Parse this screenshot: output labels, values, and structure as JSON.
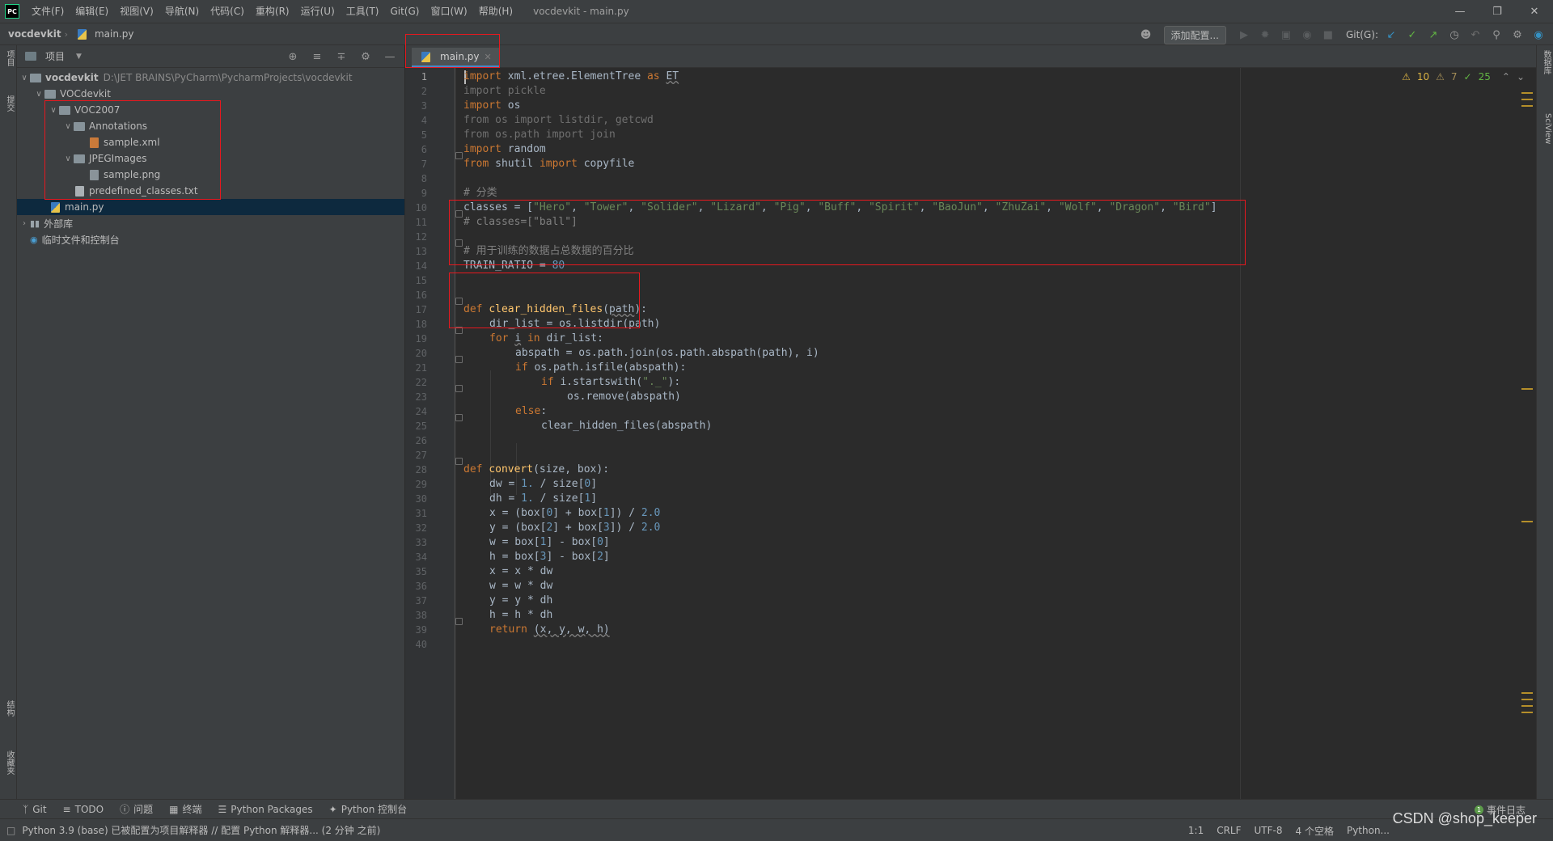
{
  "app": {
    "logo": "PC",
    "menu": [
      "文件(F)",
      "编辑(E)",
      "视图(V)",
      "导航(N)",
      "代码(C)",
      "重构(R)",
      "运行(U)",
      "工具(T)",
      "Git(G)",
      "窗口(W)",
      "帮助(H)"
    ],
    "window_title": "vocdevkit - main.py"
  },
  "navbar": {
    "project": "vocdevkit",
    "file": "main.py",
    "add_config": "添加配置...",
    "git_label": "Git(G):"
  },
  "left_strip": {
    "project": "项目",
    "commit": "提交",
    "structure": "结构",
    "bookmarks": "收藏夹"
  },
  "right_strip": {
    "database": "数据库",
    "sciview": "SciView"
  },
  "project_panel": {
    "title": "项目",
    "tree": {
      "root": "vocdevkit",
      "root_path": "D:\\JET BRAINS\\PyCharm\\PycharmProjects\\vocdevkit",
      "vocdevkit_dir": "VOCdevkit",
      "voc2007": "VOC2007",
      "annotations": "Annotations",
      "sample_xml": "sample.xml",
      "jpegimages": "JPEGImages",
      "sample_png": "sample.png",
      "predefined": "predefined_classes.txt",
      "main_py": "main.py",
      "external_libs": "外部库",
      "scratches": "临时文件和控制台"
    }
  },
  "editor": {
    "tab_label": "main.py",
    "inspections": {
      "warnings": "10",
      "weak_warnings": "7",
      "ok": "25"
    },
    "line_numbers": [
      "1",
      "2",
      "3",
      "4",
      "5",
      "6",
      "7",
      "8",
      "9",
      "10",
      "11",
      "12",
      "13",
      "14",
      "15",
      "16",
      "17",
      "18",
      "19",
      "20",
      "21",
      "22",
      "23",
      "24",
      "25",
      "26",
      "27",
      "28",
      "29",
      "30",
      "31",
      "32",
      "33",
      "34",
      "35",
      "36",
      "37",
      "38",
      "39",
      "40"
    ]
  },
  "code": {
    "l1": {
      "kw1": "import",
      "mid": " xml.etree.ElementTree ",
      "kw2": "as",
      "alias": "ET"
    },
    "l2": "import pickle",
    "l3": {
      "kw": "import",
      "rest": " os"
    },
    "l4": "from os import listdir, getcwd",
    "l5": "from os.path import join",
    "l6": {
      "kw": "import",
      "rest": " random"
    },
    "l7": {
      "kw1": "from",
      "mid": " shutil ",
      "kw2": "import",
      "rest": " copyfile"
    },
    "l9": "# 分类",
    "l10": {
      "prefix": "classes = [",
      "items": [
        "\"Hero\"",
        "\"Tower\"",
        "\"Solider\"",
        "\"Lizard\"",
        "\"Pig\"",
        "\"Buff\"",
        "\"Spirit\"",
        "\"BaoJun\"",
        "\"ZhuZai\"",
        "\"Wolf\"",
        "\"Dragon\"",
        "\"Bird\""
      ],
      "suffix": "]"
    },
    "l11": "# classes=[\"ball\"]",
    "l13": "# 用于训练的数据占总数据的百分比",
    "l14": {
      "name": "TRAIN_RATIO = ",
      "value": "80"
    },
    "l17": {
      "kw": "def",
      "fn": "clear_hidden_files",
      "param": "path",
      "end": "):"
    },
    "l18": "dir_list = os.listdir(path)",
    "l19": {
      "kw1": "for",
      "var": "i",
      "kw2": "in",
      "rest": " dir_list:"
    },
    "l20": "abspath = os.path.join(os.path.abspath(path), i)",
    "l21": {
      "kw": "if",
      "rest": " os.path.isfile(abspath):"
    },
    "l22": {
      "kw": "if",
      "pre": " i.startswith(",
      "str": "\"._\"",
      "end": "):"
    },
    "l23": "os.remove(abspath)",
    "l24": {
      "kw": "else",
      "end": ":"
    },
    "l25": "clear_hidden_files(abspath)",
    "l28": {
      "kw": "def",
      "fn": "convert",
      "rest": "(size, box):"
    },
    "l29": {
      "pre": "dw = ",
      "n1": "1.",
      "mid": " / size[",
      "n2": "0",
      "end": "]"
    },
    "l30": {
      "pre": "dh = ",
      "n1": "1.",
      "mid": " / size[",
      "n2": "1",
      "end": "]"
    },
    "l31": {
      "a": "x = (box[",
      "n1": "0",
      "b": "] + box[",
      "n2": "1",
      "c": "]) / ",
      "n3": "2.0"
    },
    "l32": {
      "a": "y = (box[",
      "n1": "2",
      "b": "] + box[",
      "n2": "3",
      "c": "]) / ",
      "n3": "2.0"
    },
    "l33": {
      "a": "w = box[",
      "n1": "1",
      "b": "] - box[",
      "n2": "0",
      "c": "]"
    },
    "l34": {
      "a": "h = box[",
      "n1": "3",
      "b": "] - box[",
      "n2": "2",
      "c": "]"
    },
    "l35": "x = x * dw",
    "l36": "w = w * dw",
    "l37": "y = y * dh",
    "l38": "h = h * dh",
    "l39": {
      "kw": "return",
      "rest": "(x, y, w, h)"
    }
  },
  "tool_windows": {
    "git": "Git",
    "todo": "TODO",
    "problems": "问题",
    "terminal": "终端",
    "packages": "Python Packages",
    "console": "Python 控制台",
    "event_log": "事件日志"
  },
  "status": {
    "message": "Python 3.9 (base) 已被配置为项目解释器 // 配置 Python 解释器... (2 分钟 之前)",
    "position": "1:1",
    "line_sep": "CRLF",
    "encoding": "UTF-8",
    "indent": "4 个空格",
    "interpreter": "Python..."
  },
  "watermark": "CSDN @shop_keeper",
  "colors": {
    "keyword": "#cc7832",
    "function": "#ffc66d",
    "string": "#6a8759",
    "number": "#6897bb",
    "comment": "#808080",
    "highlight_box": "#e8181e"
  }
}
